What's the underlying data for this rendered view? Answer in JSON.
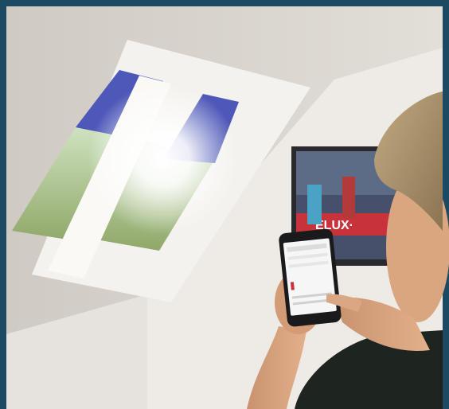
{
  "photo": {
    "frame_color": "#1c4a63",
    "wall_color": "#e9e6e1",
    "ceiling_color": "#dcd8d2",
    "blind_color": "#4d58b8",
    "tv_banner_color": "#c8323a",
    "tv_banner_text": "ELUX·"
  }
}
